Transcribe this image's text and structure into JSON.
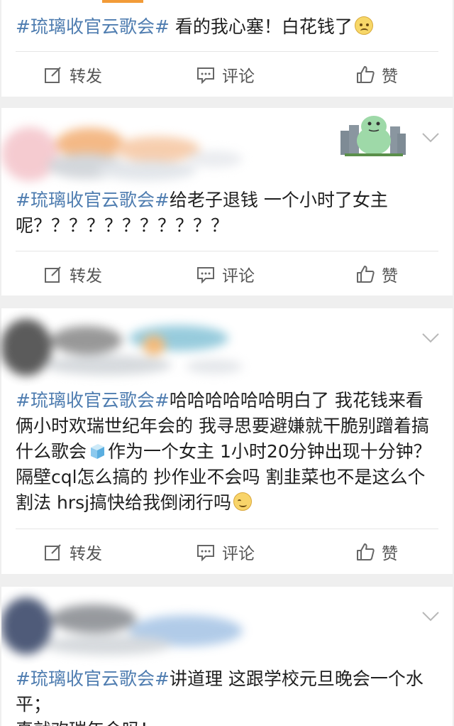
{
  "posts": [
    {
      "topic": "#琉璃收官云歌会#",
      "body": " 看的我心塞！白花钱了"
    },
    {
      "topic": "#琉璃收官云歌会#",
      "body": "给老子退钱 一个小时了女主呢？？？？？？？？？？？"
    },
    {
      "topic": "#琉璃收官云歌会#",
      "body_part1": "哈哈哈哈哈哈明白了 我花钱来看俩小时欢瑞世纪年会的 我寻思要避嫌就干脆别蹭着搞什么歌会",
      "body_part2": "作为一个女主 1小时20分钟出现十分钟？隔壁cql怎么搞的 抄作业不会吗 割韭菜也不是这么个割法 hrsj搞快给我倒闭行吗"
    },
    {
      "topic": "#琉璃收官云歌会#",
      "body": "讲道理 这跟学校元旦晚会一个水平；",
      "body_cut": "真就欢瑞年会吗！"
    }
  ],
  "actions": {
    "repost_label": "转发",
    "comment_label": "评论",
    "like_label": "赞"
  },
  "icons": {
    "repost": "edit-icon",
    "comment": "comment-icon",
    "like": "thumbs-up-icon",
    "more": "chevron-down-icon"
  },
  "colors": {
    "topic": "#4f7db0",
    "text": "#1f1f1f",
    "action_text": "#555555",
    "background": "#efefef"
  }
}
